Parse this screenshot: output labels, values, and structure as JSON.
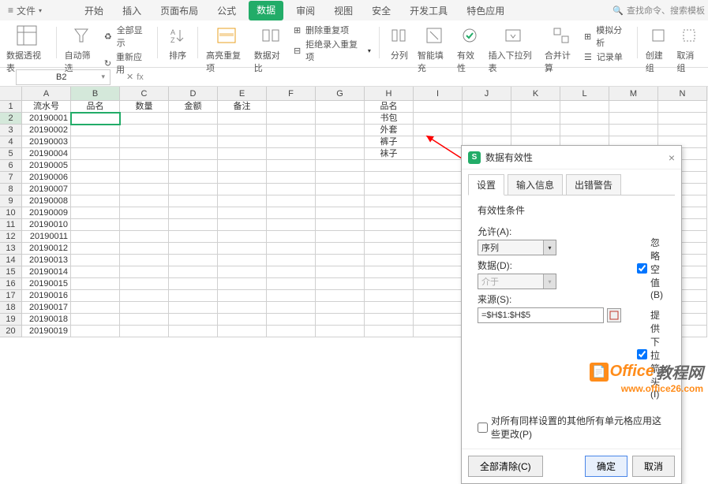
{
  "menubar": {
    "file": "文件",
    "tabs": [
      "开始",
      "插入",
      "页面布局",
      "公式",
      "数据",
      "审阅",
      "视图",
      "安全",
      "开发工具",
      "特色应用"
    ],
    "active_tab_index": 4,
    "search_placeholder": "查找命令、搜索模板"
  },
  "ribbon": {
    "pivot": "数据透视表",
    "autofilter": "自动筛选",
    "showall": "全部显示",
    "reapply": "重新应用",
    "sort": "排序",
    "highlight": "高亮重复项",
    "compare": "数据对比",
    "deldup": "删除重复项",
    "rejectdup": "拒绝录入重复项",
    "split": "分列",
    "smartfill": "智能填充",
    "validity": "有效性",
    "insertdd": "插入下拉列表",
    "consolidate": "合并计算",
    "simanalysis": "模拟分析",
    "form": "记录单",
    "newgroup": "创建组",
    "ungroup": "取消组"
  },
  "namebox": "B2",
  "fx_label": "fx",
  "columns": [
    "A",
    "B",
    "C",
    "D",
    "E",
    "F",
    "G",
    "H",
    "I",
    "J",
    "K",
    "L",
    "M",
    "N"
  ],
  "header_row": [
    "流水号",
    "品名",
    "数量",
    "金额",
    "备注"
  ],
  "h_column": [
    "品名",
    "书包",
    "外套",
    "裤子",
    "袜子"
  ],
  "serials": [
    "20190001",
    "20190002",
    "20190003",
    "20190004",
    "20190005",
    "20190006",
    "20190007",
    "20190008",
    "20190009",
    "20190010",
    "20190011",
    "20190012",
    "20190013",
    "20190014",
    "20190015",
    "20190016",
    "20190017",
    "20190018",
    "20190019"
  ],
  "dialog": {
    "title": "数据有效性",
    "tabs": [
      "设置",
      "输入信息",
      "出错警告"
    ],
    "section_label": "有效性条件",
    "allow_label": "允许(A):",
    "allow_value": "序列",
    "data_label": "数据(D):",
    "data_value": "介于",
    "source_label": "来源(S):",
    "source_value": "=$H$1:$H$5",
    "ignore_blank": "忽略空值(B)",
    "provide_dd": "提供下拉箭头(I)",
    "apply_all": "对所有同样设置的其他所有单元格应用这些更改(P)",
    "clear": "全部清除(C)",
    "ok": "确定",
    "cancel": "取消"
  },
  "watermark": {
    "brand1": "Office",
    "brand2": "教程网",
    "url": "www.office26.com"
  }
}
